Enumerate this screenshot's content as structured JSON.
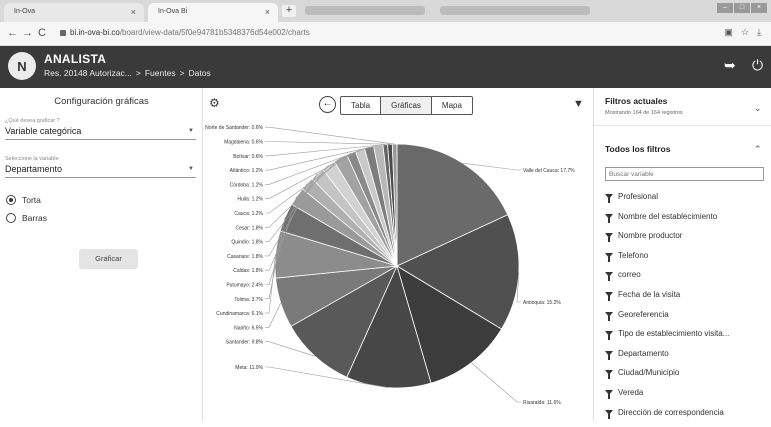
{
  "browser": {
    "tabs": [
      {
        "title": "In-Ova",
        "close": "×"
      },
      {
        "title": "In-Ova Bi",
        "close": "×"
      }
    ],
    "new_tab": "+",
    "url_host": "bi.in-ova-bi.co",
    "url_path": "/board/view-data/5f0e94781b5348376d54e002/charts"
  },
  "app": {
    "logo": "N",
    "name": "ANALISTA",
    "breadcrumbs": [
      "Res. 20148 Autorizac...",
      "Fuentes",
      "Datos"
    ],
    "icons": [
      "back-arrow-icon",
      "power-icon"
    ]
  },
  "left_panel": {
    "title": "Configuración gráficas",
    "chart_label": "¿Qué desea graficar ?",
    "chart_value": "Variable categórica",
    "variable_label": "Seleccione la variable",
    "variable_value": "Departamento",
    "radios": [
      {
        "label": "Torta",
        "selected": true
      },
      {
        "label": "Barras",
        "selected": false
      }
    ],
    "button": "Graficar"
  },
  "toolbar": {
    "tabs": [
      "Tabla",
      "Gráficas",
      "Mapa"
    ],
    "active_tab": "Gráficas"
  },
  "right_panel": {
    "current_title": "Filtros actuales",
    "current_subtitle": "Mostrando 164 de 164 registros",
    "all_title": "Todos los filtros",
    "search_placeholder": "Buscar variable",
    "filters": [
      "Profesional",
      "Nombre del establecimiento",
      "Nombre productor",
      "Telefono",
      "correo",
      "Fecha de la visita",
      "Georeferencia",
      "Tipo de establecimiento visita...",
      "Departamento",
      "Ciudad/Municipio",
      "Vereda",
      "Dirección de correspondencia"
    ]
  },
  "chart_data": {
    "type": "pie",
    "title": "",
    "slices": [
      {
        "label": "Valle del Cauca: 17.7%",
        "value": 17.7,
        "color": "#6a6a6a"
      },
      {
        "label": "Antioquia: 15.2%",
        "value": 15.2,
        "color": "#505050"
      },
      {
        "label": "Risaralda: 11.6%",
        "value": 11.6,
        "color": "#3c3c3c"
      },
      {
        "label": "Meta: 11.0%",
        "value": 11.0,
        "color": "#474747"
      },
      {
        "label": "Santander: 9.8%",
        "value": 9.8,
        "color": "#595959"
      },
      {
        "label": "Nariño: 6.5%",
        "value": 6.5,
        "color": "#7a7a7a"
      },
      {
        "label": "Cundinamarca: 6.1%",
        "value": 6.1,
        "color": "#8c8c8c"
      },
      {
        "label": "Tolima: 3.7%",
        "value": 3.7,
        "color": "#6f6f6f"
      },
      {
        "label": "Putumayo: 2.4%",
        "value": 2.4,
        "color": "#9a9a9a"
      },
      {
        "label": "Caldas: 1.8%",
        "value": 1.8,
        "color": "#b0b0b0"
      },
      {
        "label": "Casanare: 1.8%",
        "value": 1.8,
        "color": "#c4c4c4"
      },
      {
        "label": "Quindío: 1.8%",
        "value": 1.8,
        "color": "#d2d2d2"
      },
      {
        "label": "Cesar: 1.8%",
        "value": 1.8,
        "color": "#a2a2a2"
      },
      {
        "label": "Cauca: 1.2%",
        "value": 1.2,
        "color": "#8a8a8a"
      },
      {
        "label": "Huila: 1.2%",
        "value": 1.2,
        "color": "#c9c9c9"
      },
      {
        "label": "Córdoba: 1.2%",
        "value": 1.2,
        "color": "#7d7d7d"
      },
      {
        "label": "Atlántico: 1.2%",
        "value": 1.2,
        "color": "#b8b8b8"
      },
      {
        "label": "Bolívar: 0.6%",
        "value": 0.6,
        "color": "#666666"
      },
      {
        "label": "Magdalena: 0.6%",
        "value": 0.6,
        "color": "#4a4a4a"
      },
      {
        "label": "Norte de Santander: 0.6%",
        "value": 0.6,
        "color": "#999999"
      }
    ]
  }
}
